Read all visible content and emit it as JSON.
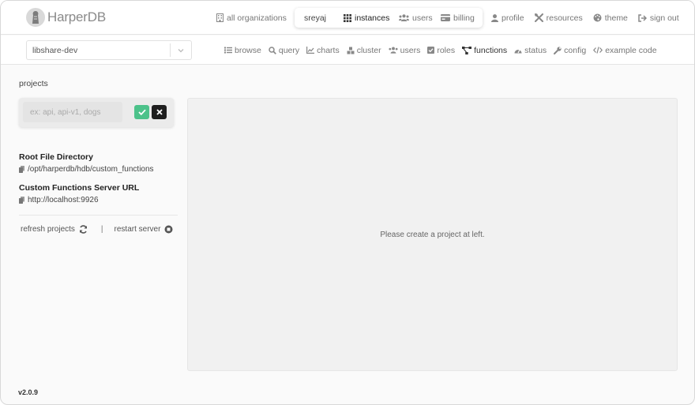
{
  "app": {
    "logo_text": "HarperDB",
    "version": "v2.0.9"
  },
  "topnav": {
    "all_organizations": "all organizations",
    "org_name": "sreyaj",
    "instances": "instances",
    "users": "users",
    "billing": "billing",
    "profile": "profile",
    "resources": "resources",
    "theme": "theme",
    "sign_out": "sign out"
  },
  "instance": {
    "selected": "libshare-dev"
  },
  "subnav": {
    "items": [
      {
        "label": "browse",
        "icon": "list-icon"
      },
      {
        "label": "query",
        "icon": "search-icon"
      },
      {
        "label": "charts",
        "icon": "chart-icon"
      },
      {
        "label": "cluster",
        "icon": "cubes-icon"
      },
      {
        "label": "users",
        "icon": "users-icon"
      },
      {
        "label": "roles",
        "icon": "check-square-icon"
      },
      {
        "label": "functions",
        "icon": "project-diagram-icon",
        "active": true
      },
      {
        "label": "status",
        "icon": "gauge-icon"
      },
      {
        "label": "config",
        "icon": "wrench-icon"
      },
      {
        "label": "example code",
        "icon": "code-icon"
      }
    ]
  },
  "projects": {
    "label": "projects",
    "input_placeholder": "ex: api, api-v1, dogs",
    "input_value": ""
  },
  "info": {
    "root_dir_title": "Root File Directory",
    "root_dir_value": "/opt/harperdb/hdb/custom_functions",
    "server_url_title": "Custom Functions Server URL",
    "server_url_value": "http://localhost:9926"
  },
  "actions": {
    "refresh": "refresh projects",
    "separator": "|",
    "restart": "restart server"
  },
  "main": {
    "empty_message": "Please create a project at left."
  },
  "colors": {
    "confirm": "#4cc28a",
    "cancel": "#1e1e1e"
  }
}
